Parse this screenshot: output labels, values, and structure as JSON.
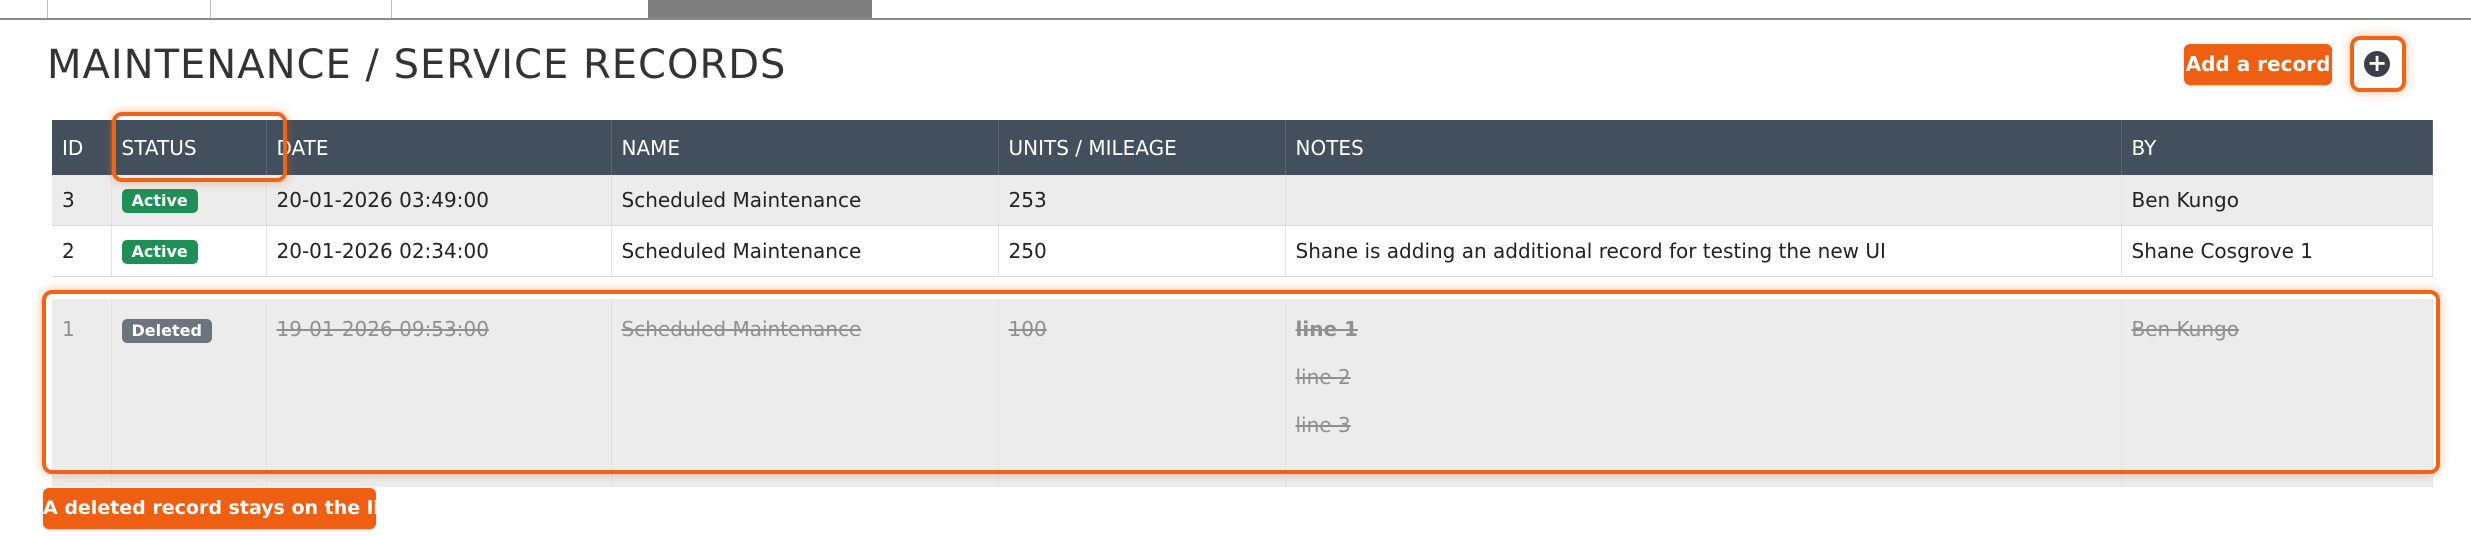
{
  "page": {
    "title": "MAINTENANCE / SERVICE RECORDS"
  },
  "actions": {
    "add_record_label": "Add a record",
    "add_icon": "plus-circle-icon"
  },
  "annotation": {
    "deleted_note": "A deleted record stays on the list"
  },
  "colors": {
    "accent": "#ee5f12",
    "header_bg": "#434f5c",
    "badge_active": "#1e8f57",
    "badge_deleted": "#6c757d"
  },
  "table": {
    "columns": [
      "ID",
      "STATUS",
      "DATE",
      "NAME",
      "UNITS / MILEAGE",
      "NOTES",
      "BY"
    ],
    "rows": [
      {
        "id": "3",
        "status": "Active",
        "date": "20-01-2026 03:49:00",
        "name": "Scheduled Maintenance",
        "units": "253",
        "notes": "",
        "by": "Ben Kungo"
      },
      {
        "id": "2",
        "status": "Active",
        "date": "20-01-2026 02:34:00",
        "name": "Scheduled Maintenance",
        "units": "250",
        "notes": "Shane is adding an additional record for testing the new UI",
        "by": "Shane Cosgrove 1"
      },
      {
        "id": "1",
        "status": "Deleted",
        "date": "19-01-2026 09:53:00",
        "name": "Scheduled Maintenance",
        "units": "100",
        "notes": [
          "line 1",
          "line 2",
          "line 3"
        ],
        "by": "Ben Kungo"
      }
    ]
  }
}
